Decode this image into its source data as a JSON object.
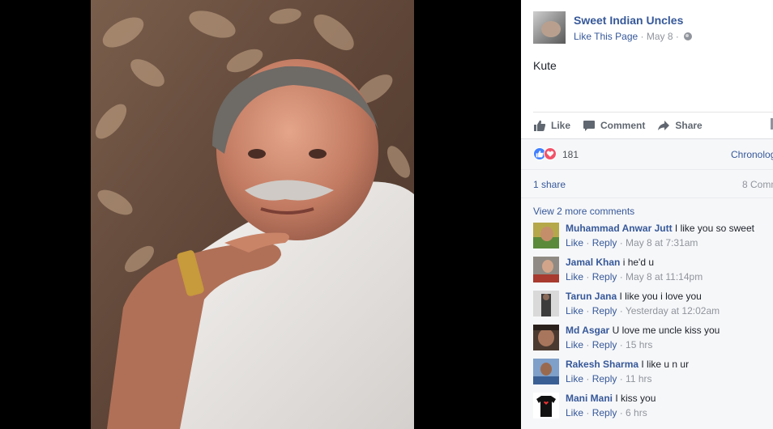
{
  "post": {
    "page_name": "Sweet Indian Uncles",
    "like_page": "Like This Page",
    "separator": " · ",
    "date": "May 8",
    "text": "Kute"
  },
  "actions": {
    "like": "Like",
    "comment": "Comment",
    "share": "Share"
  },
  "stats": {
    "reactions": "181",
    "order": "Chronolog",
    "shares": "1 share",
    "comments": "8 Comm"
  },
  "comments_section": {
    "view_more": "View 2 more comments",
    "items": [
      {
        "author": "Muhammad Anwar Jutt",
        "text": " I like you so sweet",
        "like": "Like",
        "reply": "Reply",
        "time": " · May 8 at 7:31am"
      },
      {
        "author": "Jamal Khan",
        "text": " i he'd u",
        "like": "Like",
        "reply": "Reply",
        "time": " · May 8 at 11:14pm"
      },
      {
        "author": "Tarun Jana",
        "text": " I like you i love you",
        "like": "Like",
        "reply": "Reply",
        "time": " · Yesterday at 12:02am"
      },
      {
        "author": "Md Asgar",
        "text": " U love me uncle kiss you",
        "like": "Like",
        "reply": "Reply",
        "time": " · 15 hrs"
      },
      {
        "author": "Rakesh Sharma",
        "text": " I like u n ur",
        "like": "Like",
        "reply": "Reply",
        "time": " · 11 hrs"
      },
      {
        "author": "Mani Mani",
        "text": " I kiss you",
        "like": "Like",
        "reply": "Reply",
        "time": " · 6 hrs"
      }
    ],
    "dot": " · "
  },
  "colors": {
    "link": "#365899",
    "like_reaction": "#4080ff",
    "love_reaction": "#f25268"
  }
}
